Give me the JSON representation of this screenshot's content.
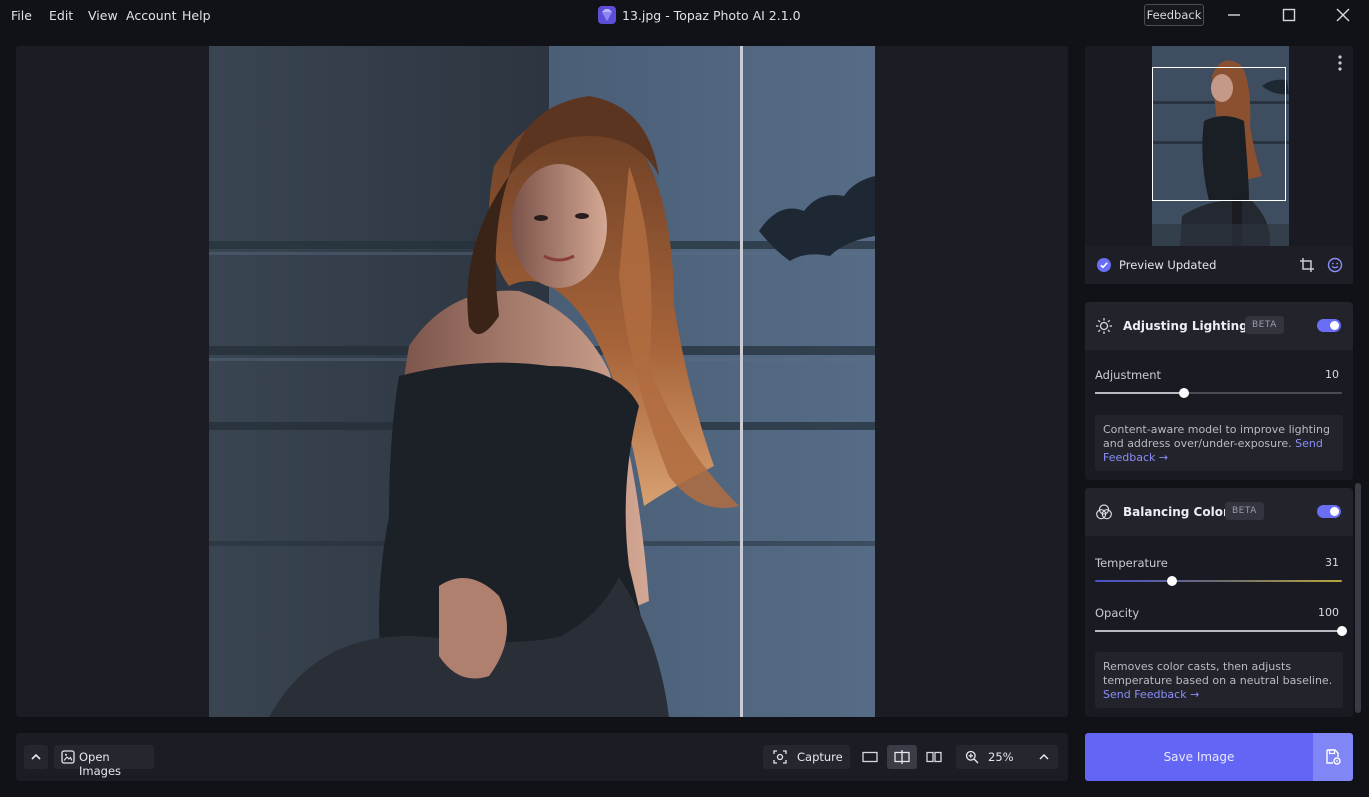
{
  "menu": {
    "file": "File",
    "edit": "Edit",
    "view": "View",
    "account": "Account",
    "help": "Help"
  },
  "window": {
    "title": "13.jpg - Topaz Photo AI 2.1.0",
    "feedback_label": "Feedback"
  },
  "preview": {
    "status": "Preview Updated"
  },
  "lighting": {
    "title": "Adjusting Lighting",
    "badge": "BETA",
    "enabled": true,
    "adjustment_label": "Adjustment",
    "adjustment_value": "10",
    "adjustment_fraction": 0.36,
    "description": "Content-aware model to improve lighting and address over/under-exposure. ",
    "description_link": "Send Feedback →"
  },
  "color": {
    "title": "Balancing Color",
    "badge": "BETA",
    "enabled": true,
    "temperature_label": "Temperature",
    "temperature_value": "31",
    "temperature_fraction": 0.31,
    "opacity_label": "Opacity",
    "opacity_value": "100",
    "opacity_fraction": 1.0,
    "description": "Removes color casts, then adjusts temperature based on a neutral baseline. ",
    "description_link": "Send Feedback →"
  },
  "bottom": {
    "open_images_label": "Open Images",
    "capture_label": "Capture",
    "zoom_label": "25%"
  },
  "save": {
    "label": "Save Image"
  },
  "colors": {
    "accent": "#6366f5",
    "accent_light": "#8186f7",
    "link": "#8a8ff8"
  },
  "icons": {
    "logo": "topaz-gem-icon",
    "minimize": "minimize-icon",
    "maximize": "maximize-icon",
    "close": "close-icon",
    "kebab": "more-vertical-icon",
    "preview_check": "check-circle-icon",
    "crop": "crop-icon",
    "face": "face-icon",
    "lighting": "sun-icon",
    "color": "color-balance-icon",
    "collapse": "chevron-up-icon",
    "open_images": "image-icon",
    "capture": "capture-icon",
    "view_single": "single-view-icon",
    "view_split": "split-view-icon",
    "view_side": "side-by-side-icon",
    "zoom": "zoom-in-icon",
    "zoom_menu": "chevron-up-icon",
    "save_options": "save-settings-icon"
  }
}
